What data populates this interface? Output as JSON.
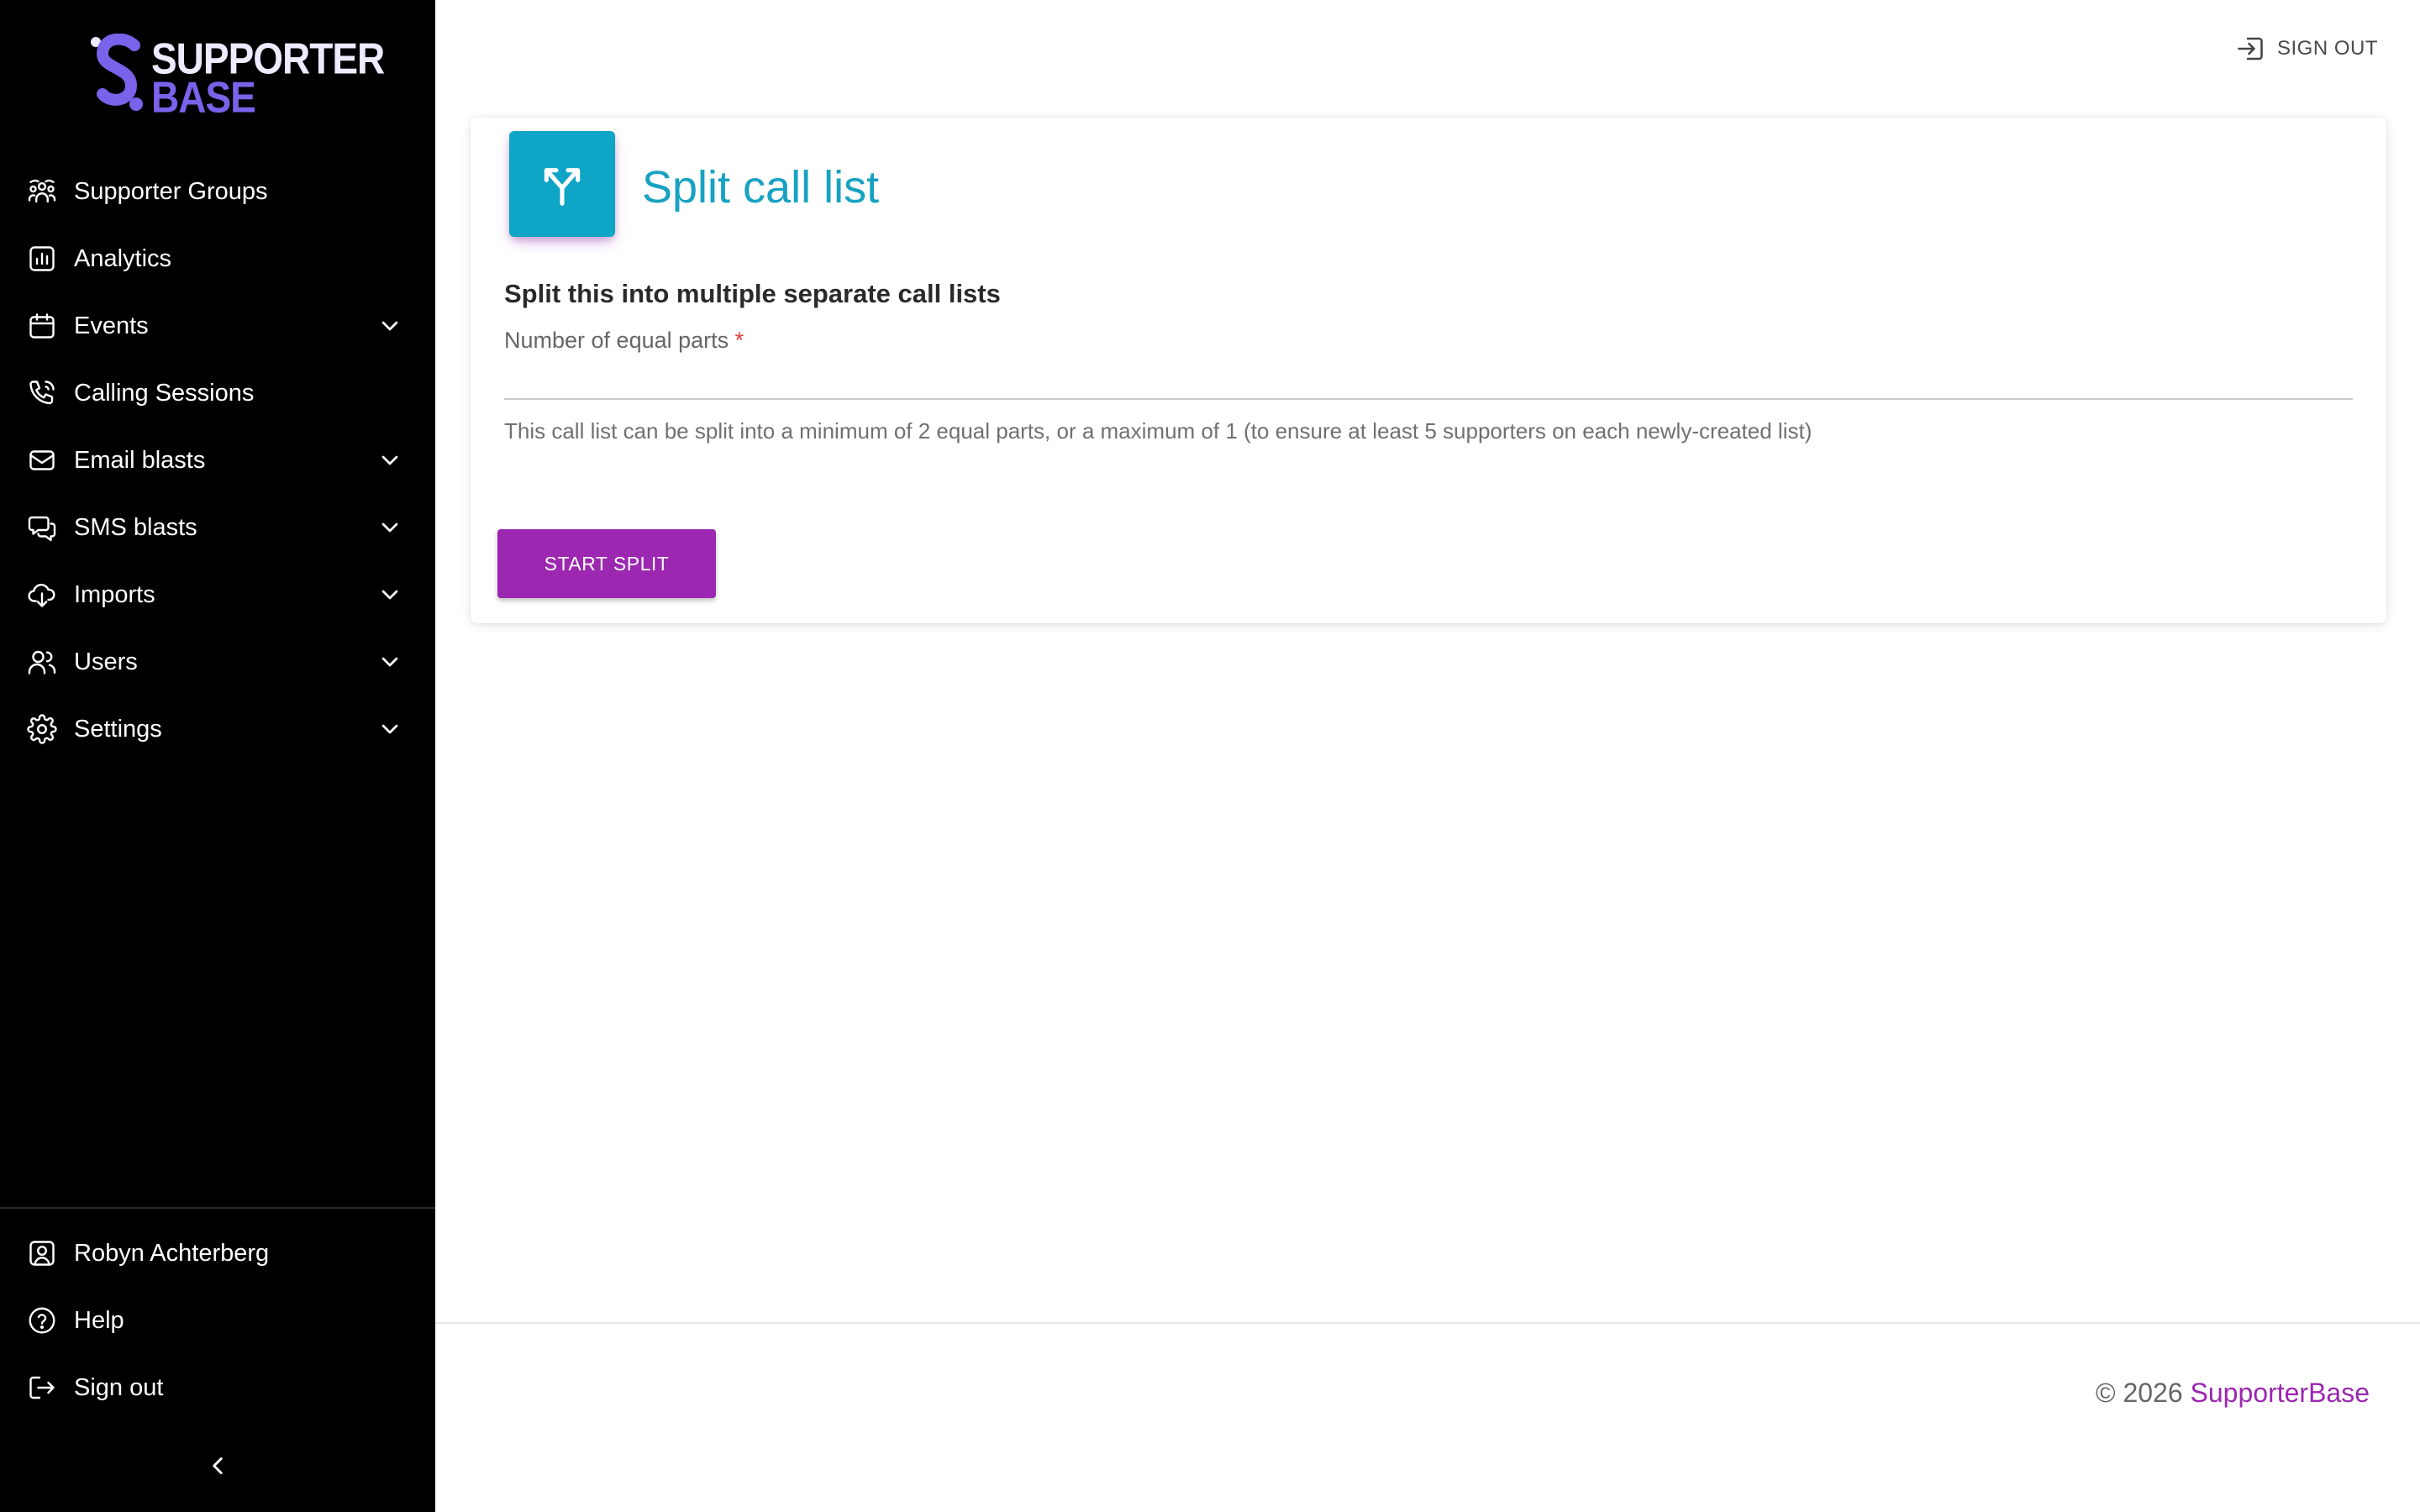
{
  "brand": {
    "line1": "SUPPORTER",
    "line2": "BASE",
    "colors": {
      "primary": "#eeeaff",
      "accent": "#7b62ea"
    }
  },
  "sidebar": {
    "items": [
      {
        "label": "Supporter Groups",
        "icon": "people-group-icon",
        "expandable": false
      },
      {
        "label": "Analytics",
        "icon": "bar-chart-icon",
        "expandable": false
      },
      {
        "label": "Events",
        "icon": "calendar-icon",
        "expandable": true
      },
      {
        "label": "Calling Sessions",
        "icon": "phone-icon",
        "expandable": false
      },
      {
        "label": "Email blasts",
        "icon": "envelope-icon",
        "expandable": true
      },
      {
        "label": "SMS blasts",
        "icon": "chat-bubbles-icon",
        "expandable": true
      },
      {
        "label": "Imports",
        "icon": "cloud-download-icon",
        "expandable": true
      },
      {
        "label": "Users",
        "icon": "users-icon",
        "expandable": true
      },
      {
        "label": "Settings",
        "icon": "gear-icon",
        "expandable": true
      }
    ],
    "bottom": [
      {
        "label": "Robyn Achterberg",
        "icon": "user-badge-icon"
      },
      {
        "label": "Help",
        "icon": "help-circle-icon"
      },
      {
        "label": "Sign out",
        "icon": "logout-icon"
      }
    ],
    "collapse_icon": "chevron-left-icon"
  },
  "topbar": {
    "sign_out_label": "SIGN OUT",
    "sign_out_icon": "sign-out-icon"
  },
  "card": {
    "icon": "split-arrows-icon",
    "title": "Split call list",
    "section_title": "Split this into multiple separate call lists",
    "field": {
      "label": "Number of equal parts",
      "required_mark": "*",
      "value": ""
    },
    "helper": "This call list can be split into a minimum of 2 equal parts, or a maximum of 1 (to ensure at least 5 supporters on each newly-created list)",
    "button_label": "START SPLIT"
  },
  "footer": {
    "copyright": "© 2026",
    "link": "SupporterBase"
  },
  "colors": {
    "sidebar_bg": "#000000",
    "title": "#17a2c2",
    "button": "#9c27b0",
    "icon_bg": "#0ea5c6"
  }
}
